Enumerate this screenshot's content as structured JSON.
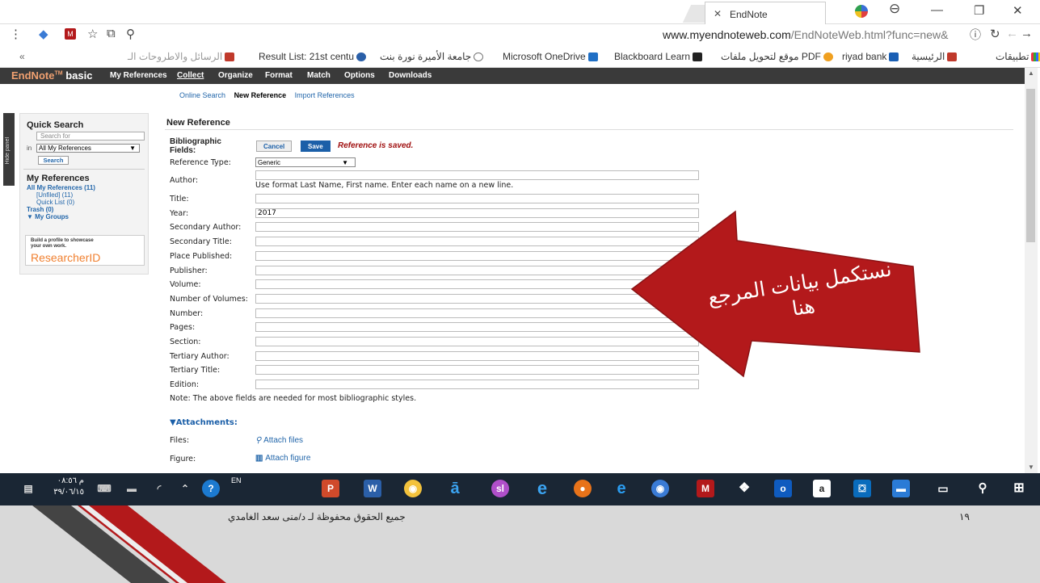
{
  "browser": {
    "tab_title": "EndNote",
    "url": "www.myendnoteweb.com/EndNoteWeb.html?func=new&",
    "url_host": "www.myendnoteweb.com",
    "url_path": "/EndNoteWeb.html?func=new&",
    "bookmarks": [
      "تطبيقات",
      "الرئيسية",
      "riyad bank",
      "موقع لتحويل ملفات ‎PDF",
      "Blackboard Learn",
      "Microsoft OneDrive",
      "جامعة الأميرة نورة بنت",
      "Result List: 21st centu",
      "الرسائل والاطروحات الـ"
    ]
  },
  "endnote": {
    "brand": "EndNote",
    "brand_tm": "TM",
    "brand_suffix": "basic",
    "menu": [
      "My References",
      "Collect",
      "Organize",
      "Format",
      "Match",
      "Options",
      "Downloads"
    ],
    "submenu": [
      "Online Search",
      "New Reference",
      "Import References"
    ],
    "quick_search": {
      "title": "Quick Search",
      "placeholder": "Search for",
      "in_label": "in",
      "scope": "All My References",
      "button": "Search"
    },
    "my_refs": {
      "title": "My References",
      "all": "All My References (11)",
      "unfiled": "[Unfiled] (11)",
      "quick": "Quick List (0)",
      "trash": "Trash (0)",
      "groups": "▼ My Groups"
    },
    "promo_line1": "Build a profile to showcase",
    "promo_line2": "your own work.",
    "promo_brand": "ResearcherID",
    "hide_panel": "Hide panel",
    "page_title": "New Reference",
    "bib_label_1": "Bibliographic",
    "bib_label_2": "Fields:",
    "cancel": "Cancel",
    "save": "Save",
    "saved_msg": "Reference is saved.",
    "ref_type_label": "Reference Type:",
    "ref_type": "Generic",
    "author_label": "Author:",
    "author_hint": "Use format Last Name, First name. Enter each name on a new line.",
    "fields": [
      {
        "label": "Title:",
        "value": ""
      },
      {
        "label": "Year:",
        "value": "2017"
      },
      {
        "label": "Secondary Author:",
        "value": ""
      },
      {
        "label": "Secondary Title:",
        "value": ""
      },
      {
        "label": "Place Published:",
        "value": ""
      },
      {
        "label": "Publisher:",
        "value": ""
      },
      {
        "label": "Volume:",
        "value": ""
      },
      {
        "label": "Number of Volumes:",
        "value": ""
      },
      {
        "label": "Number:",
        "value": ""
      },
      {
        "label": "Pages:",
        "value": ""
      },
      {
        "label": "Section:",
        "value": ""
      },
      {
        "label": "Tertiary Author:",
        "value": ""
      },
      {
        "label": "Tertiary Title:",
        "value": ""
      },
      {
        "label": "Edition:",
        "value": ""
      }
    ],
    "fields_note": "Note: The above fields are needed for most bibliographic styles.",
    "attachments_title": "▼Attachments:",
    "files_label": "Files:",
    "attach_files": "Attach files",
    "figure_label": "Figure:",
    "attach_figure": "Attach figure"
  },
  "taskbar": {
    "time": "م ٠٨:٥٦",
    "date": "٣٩/٠٦/١٥",
    "lang": "EN"
  },
  "slide": {
    "callout": "نستكمل بيانات المرجع هنا",
    "footer": "جميع الحقوق محفوظة لـ د/منى سعد الغامدي",
    "page_number": "١٩"
  },
  "colors": {
    "menu_bg": "#3a3a3a",
    "callout_red": "#b3191b",
    "taskbar": "#1a2634",
    "save_blue": "#1b5fa8"
  }
}
